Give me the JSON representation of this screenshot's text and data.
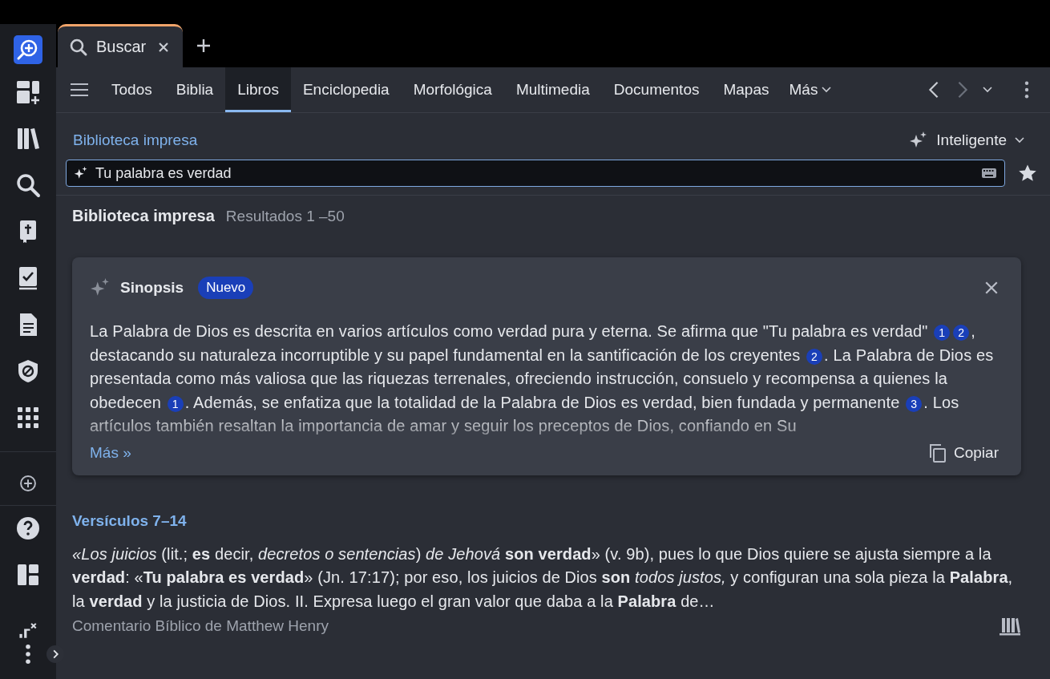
{
  "tabs": [
    {
      "label": "Buscar",
      "selected": true
    }
  ],
  "filters": [
    {
      "label": "Todos",
      "selected": false
    },
    {
      "label": "Biblia",
      "selected": false
    },
    {
      "label": "Libros",
      "selected": true
    },
    {
      "label": "Enciclopedia",
      "selected": false
    },
    {
      "label": "Morfológica",
      "selected": false
    },
    {
      "label": "Multimedia",
      "selected": false
    },
    {
      "label": "Documentos",
      "selected": false
    },
    {
      "label": "Mapas",
      "selected": false
    }
  ],
  "more_filters": "Más",
  "scope": "Biblioteca impresa",
  "mode": "Inteligente",
  "search": {
    "value": "Tu palabra es verdad"
  },
  "results_header": {
    "title": "Biblioteca impresa",
    "range": "Resultados 1 –50"
  },
  "synopsis": {
    "title": "Sinopsis",
    "badge": "Nuevo",
    "segments": [
      {
        "kind": "text",
        "text": "La Palabra de Dios es descrita en varios artículos como verdad pura y eterna. Se afirma que \"Tu palabra es verdad\" "
      },
      {
        "kind": "cite",
        "text": "1"
      },
      {
        "kind": "cite",
        "text": "2"
      },
      {
        "kind": "text",
        "text": ", destacando su naturaleza incorruptible y su papel fundamental en la santificación de los creyentes "
      },
      {
        "kind": "cite",
        "text": "2"
      },
      {
        "kind": "text",
        "text": ". La Palabra de Dios es presentada como más valiosa que las riquezas terrenales, ofreciendo instrucción, consuelo y recompensa a quienes la obedecen "
      },
      {
        "kind": "cite",
        "text": "1"
      },
      {
        "kind": "text",
        "text": ". Además, se enfatiza que la totalidad de la Palabra de Dios es verdad, bien fundada y permanente "
      },
      {
        "kind": "cite",
        "text": "3"
      },
      {
        "kind": "text",
        "text": ". Los artículos también resaltan la importancia de amar y seguir los preceptos de Dios, confiando en Su"
      }
    ],
    "more": "Más »",
    "copy": "Copiar"
  },
  "result": {
    "heading": "Versículos 7–14",
    "text": "*«Los juicios* (lit.; **es** decir, *decretos o sentencias*) *de Jehová* **son verdad**» (v. 9b), pues lo que Dios quiere se ajusta siempre a la **verdad**: «**Tu palabra es verdad**» (Jn. 17:17); por eso, los juicios de Dios **son** *todos justos,* y configuran una sola pieza la **Palabra**, la **verdad** y la justicia de Dios. II. Expresa luego el gran valor que daba a la **Palabra** de…",
    "source": "Comentario Bíblico de Matthew Henry"
  }
}
